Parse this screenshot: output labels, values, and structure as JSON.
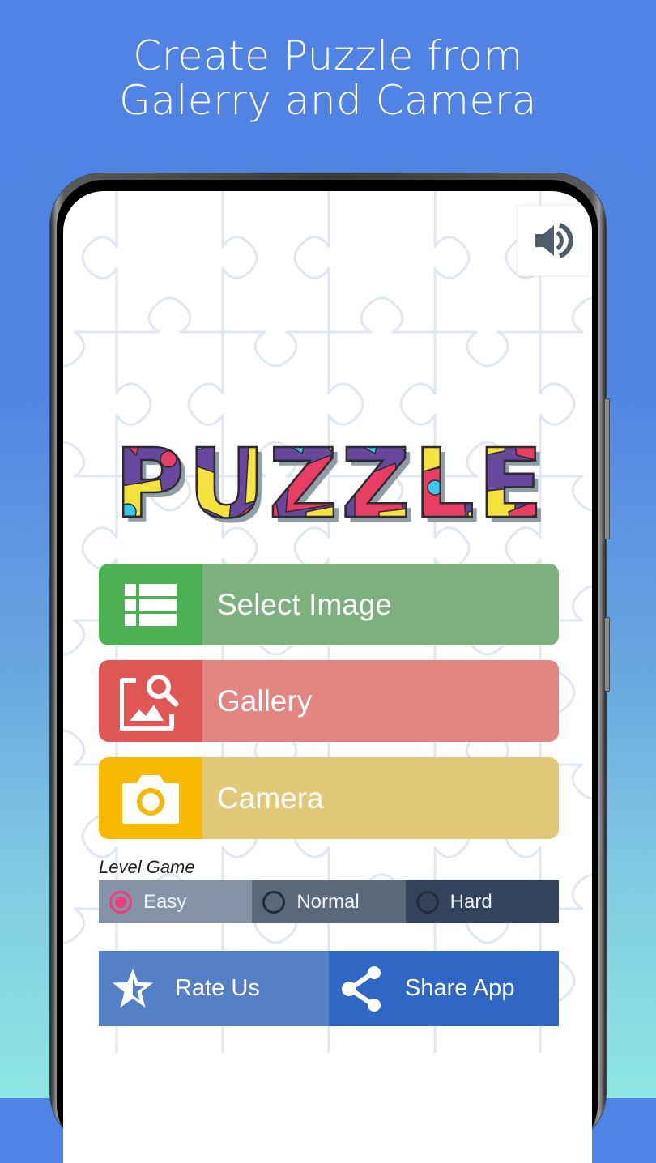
{
  "headline": {
    "line1": "Create Puzzle from",
    "line2": "Galerry and Camera"
  },
  "sound_button": {
    "icon": "volume-icon",
    "state": "on"
  },
  "logo": {
    "text": "PUZZLE",
    "colors": {
      "purple": "#67489c",
      "red": "#e83e63",
      "yellow": "#f5e23c",
      "cyan": "#3fc6ef",
      "outline": "#2e2a33",
      "shadow": "#8f9ea6"
    }
  },
  "menu": [
    {
      "label": "Select Image",
      "icon": "list-icon",
      "icon_bg": "#4db052",
      "label_bg": "#7eb07f"
    },
    {
      "label": "Gallery",
      "icon": "image-search-icon",
      "icon_bg": "#e15755",
      "label_bg": "#e38681"
    },
    {
      "label": "Camera",
      "icon": "camera-icon",
      "icon_bg": "#f7b801",
      "label_bg": "#e2c97a"
    }
  ],
  "level": {
    "label": "Level Game",
    "options": [
      {
        "label": "Easy",
        "selected": true,
        "bg": "#8494a6"
      },
      {
        "label": "Normal",
        "selected": false,
        "bg": "#5a6879"
      },
      {
        "label": "Hard",
        "selected": false,
        "bg": "#33435c"
      }
    ],
    "accent": "#f03c7a"
  },
  "actions": {
    "rate": {
      "label": "Rate Us",
      "icon": "star-half-icon",
      "bg": "#5680c6"
    },
    "share": {
      "label": "Share App",
      "icon": "share-icon",
      "bg": "#3066c4"
    }
  }
}
